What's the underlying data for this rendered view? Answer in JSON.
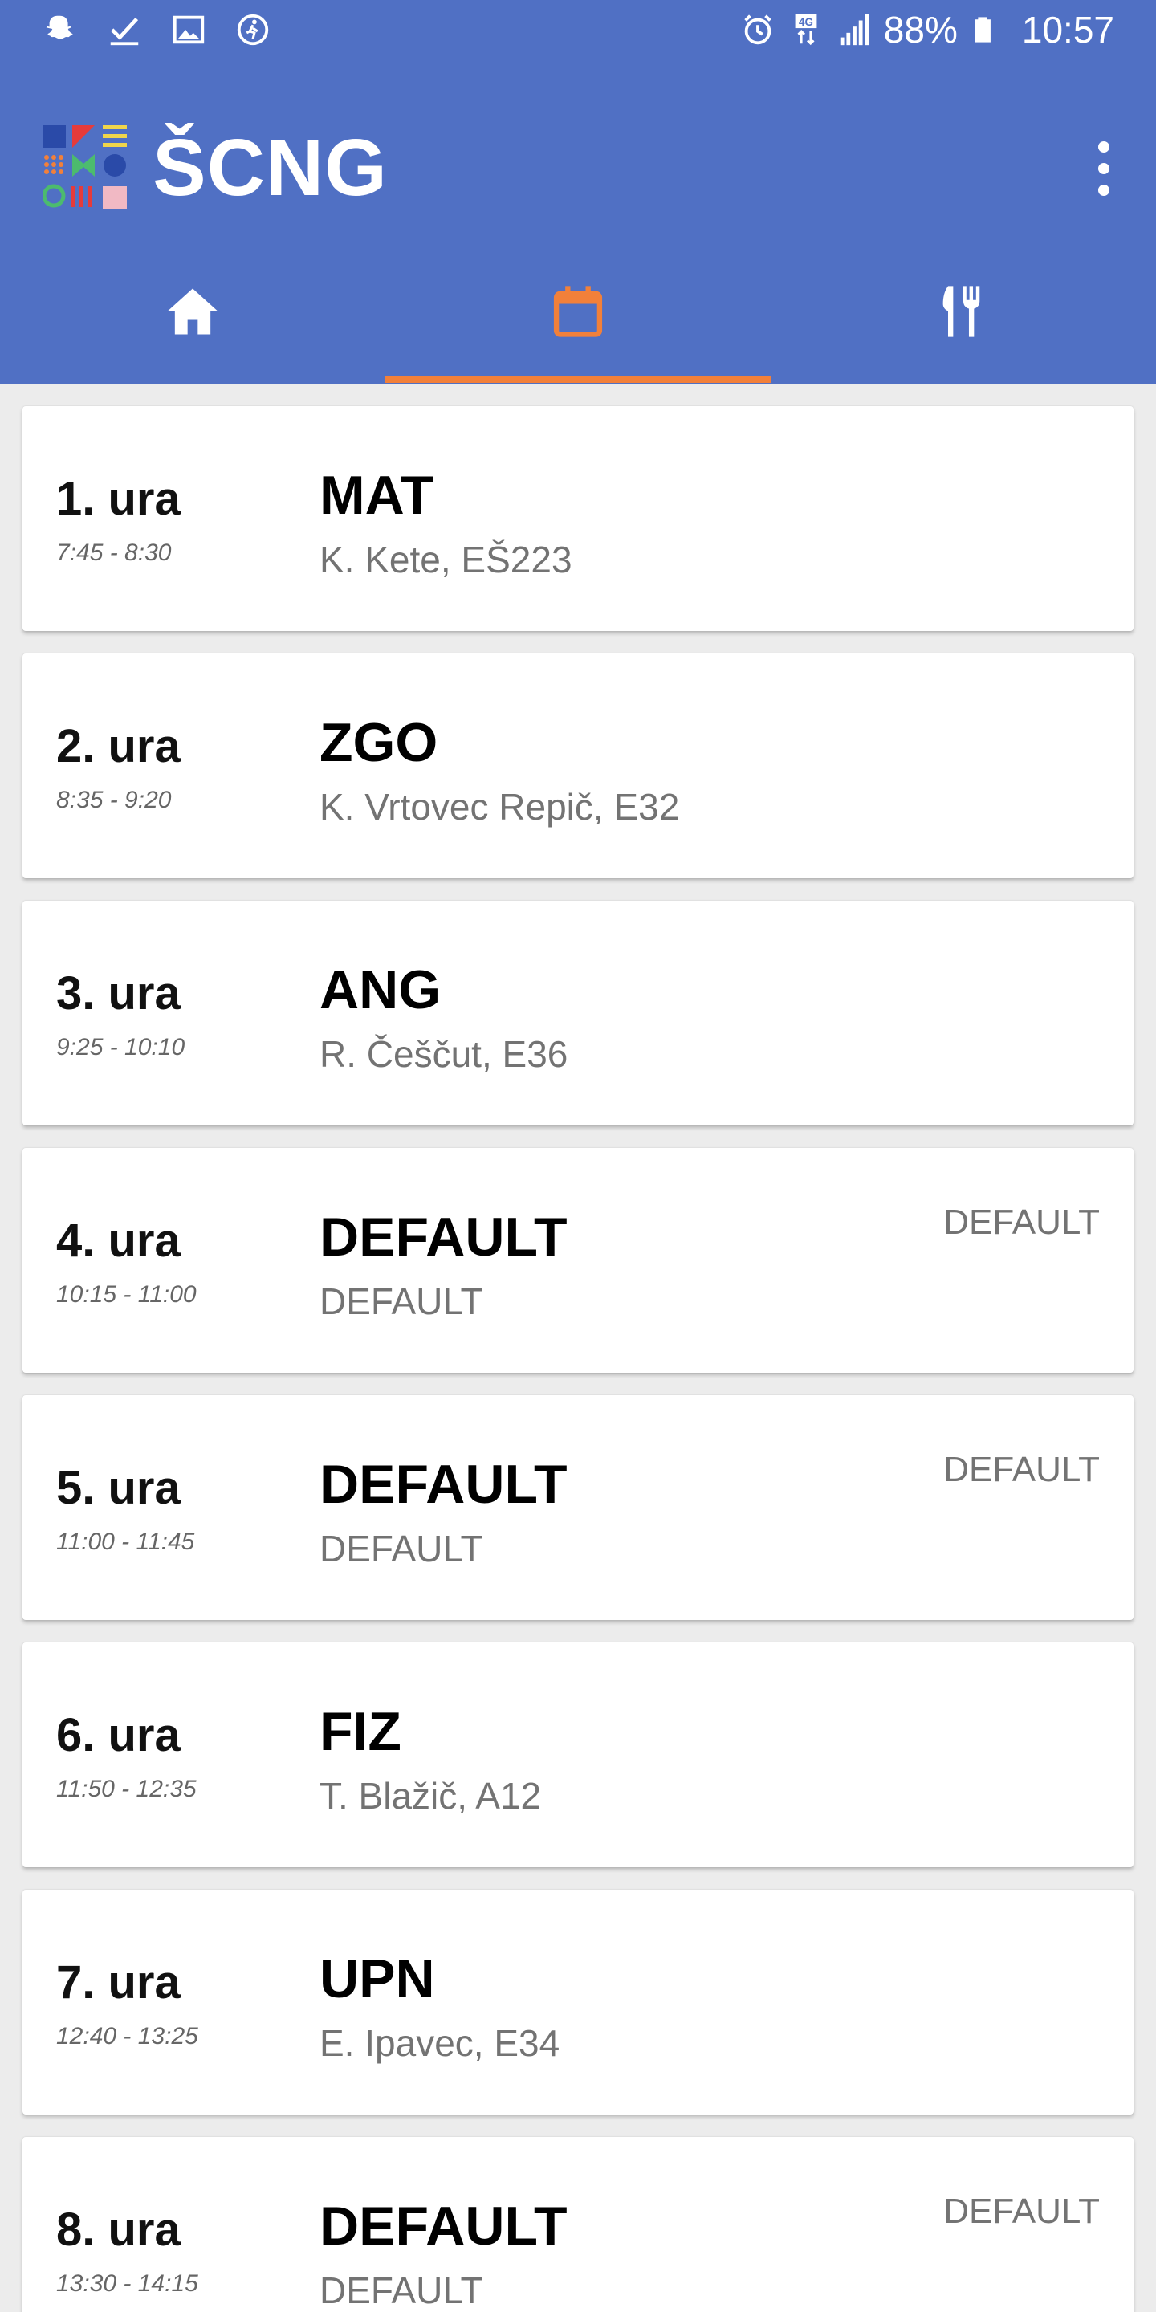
{
  "status_bar": {
    "left_icons": [
      "snapchat-icon",
      "checkmark-icon",
      "image-icon",
      "activity-icon"
    ],
    "right_icons": [
      "alarm-icon",
      "4g-icon",
      "signal-icon"
    ],
    "battery": "88%",
    "time": "10:57"
  },
  "app": {
    "title": "ŠCNG",
    "colors": {
      "primary": "#5070c4",
      "accent": "#f2803a"
    }
  },
  "tabs": [
    {
      "name": "home",
      "icon": "home-icon",
      "selected": false
    },
    {
      "name": "schedule",
      "icon": "calendar-icon",
      "selected": true
    },
    {
      "name": "menu",
      "icon": "fork-knife-icon",
      "selected": false
    }
  ],
  "lessons": [
    {
      "period": "1. ura",
      "time": "7:45 - 8:30",
      "subject": "MAT",
      "details": "K. Kete, EŠ223",
      "note": ""
    },
    {
      "period": "2. ura",
      "time": "8:35 - 9:20",
      "subject": "ZGO",
      "details": "K. Vrtovec Repič, E32",
      "note": ""
    },
    {
      "period": "3. ura",
      "time": "9:25 - 10:10",
      "subject": "ANG",
      "details": "R. Češčut, E36",
      "note": ""
    },
    {
      "period": "4. ura",
      "time": "10:15 - 11:00",
      "subject": "DEFAULT",
      "details": "DEFAULT",
      "note": "DEFAULT"
    },
    {
      "period": "5. ura",
      "time": "11:00 - 11:45",
      "subject": "DEFAULT",
      "details": "DEFAULT",
      "note": "DEFAULT"
    },
    {
      "period": "6. ura",
      "time": "11:50 - 12:35",
      "subject": "FIZ",
      "details": "T. Blažič, A12",
      "note": ""
    },
    {
      "period": "7. ura",
      "time": "12:40 - 13:25",
      "subject": "UPN",
      "details": "E. Ipavec, E34",
      "note": ""
    },
    {
      "period": "8. ura",
      "time": "13:30 - 14:15",
      "subject": "DEFAULT",
      "details": "DEFAULT",
      "note": "DEFAULT"
    }
  ]
}
